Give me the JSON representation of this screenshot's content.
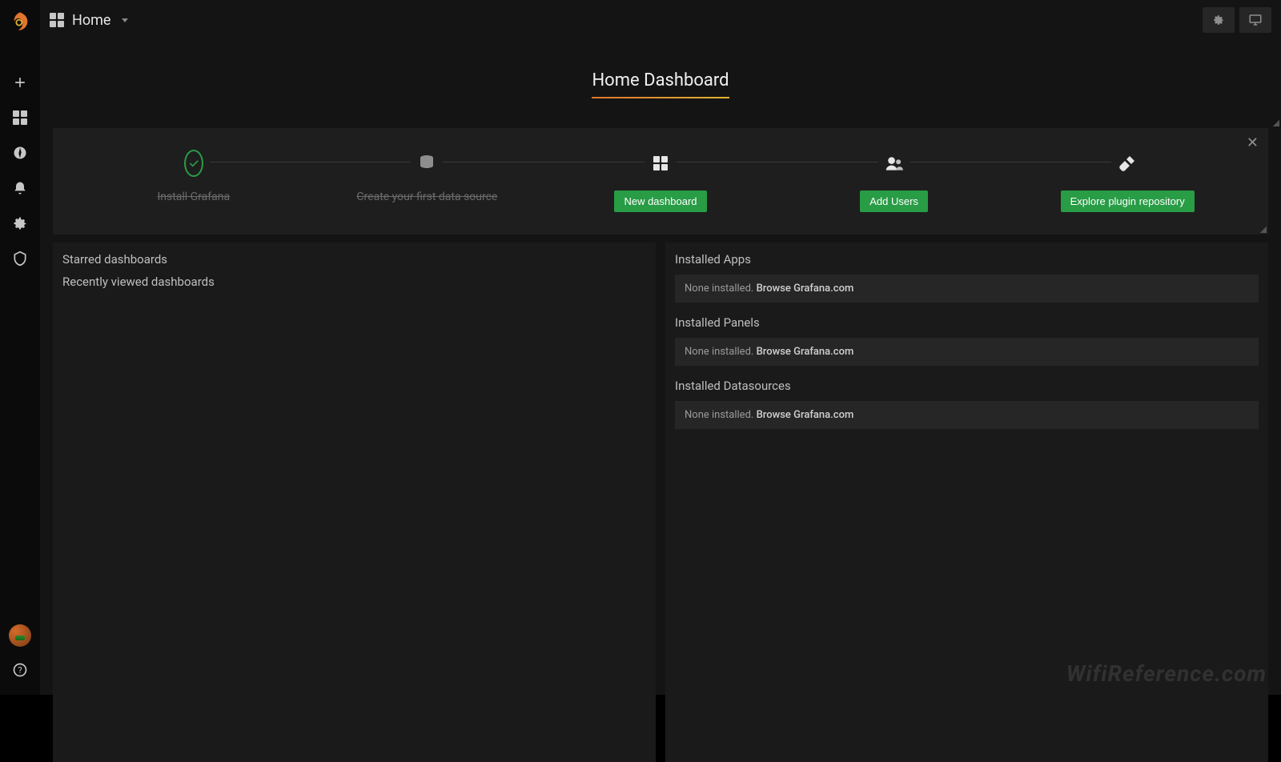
{
  "topbar": {
    "title": "Home"
  },
  "hero": {
    "title": "Home Dashboard"
  },
  "steps": {
    "install": "Install Grafana",
    "datasource": "Create your first data source",
    "new_dashboard_btn": "New dashboard",
    "add_users_btn": "Add Users",
    "explore_plugin_btn": "Explore plugin repository"
  },
  "left_panel": {
    "starred": "Starred dashboards",
    "recent": "Recently viewed dashboards"
  },
  "right_panel": {
    "apps_title": "Installed Apps",
    "panels_title": "Installed Panels",
    "datasources_title": "Installed Datasources",
    "none_prefix": "None installed. ",
    "browse_link": "Browse Grafana.com"
  },
  "watermark": "WifiReference.com"
}
